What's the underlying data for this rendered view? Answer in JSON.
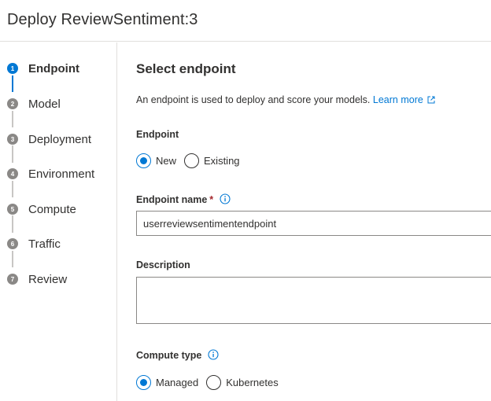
{
  "header": {
    "title": "Deploy ReviewSentiment:3"
  },
  "steps": [
    {
      "num": "1",
      "label": "Endpoint",
      "active": true
    },
    {
      "num": "2",
      "label": "Model"
    },
    {
      "num": "3",
      "label": "Deployment"
    },
    {
      "num": "4",
      "label": "Environment"
    },
    {
      "num": "5",
      "label": "Compute"
    },
    {
      "num": "6",
      "label": "Traffic"
    },
    {
      "num": "7",
      "label": "Review"
    }
  ],
  "main": {
    "heading": "Select endpoint",
    "intro_text": "An endpoint is used to deploy and score your models.",
    "learn_more": "Learn more",
    "endpoint_label": "Endpoint",
    "endpoint_options": [
      {
        "label": "New",
        "selected": true
      },
      {
        "label": "Existing",
        "selected": false
      }
    ],
    "endpoint_name_label": "Endpoint name",
    "required_mark": "*",
    "endpoint_name_value": "userreviewsentimentendpoint",
    "description_label": "Description",
    "description_value": "",
    "compute_type_label": "Compute type",
    "compute_options": [
      {
        "label": "Managed",
        "selected": true
      },
      {
        "label": "Kubernetes",
        "selected": false
      }
    ]
  },
  "colors": {
    "accent": "#0078d4",
    "required": "#a4262c",
    "border": "#8a8886",
    "divider": "#e1dfdd"
  },
  "icons": {
    "info": "info-icon",
    "external_link": "external-link-icon"
  }
}
